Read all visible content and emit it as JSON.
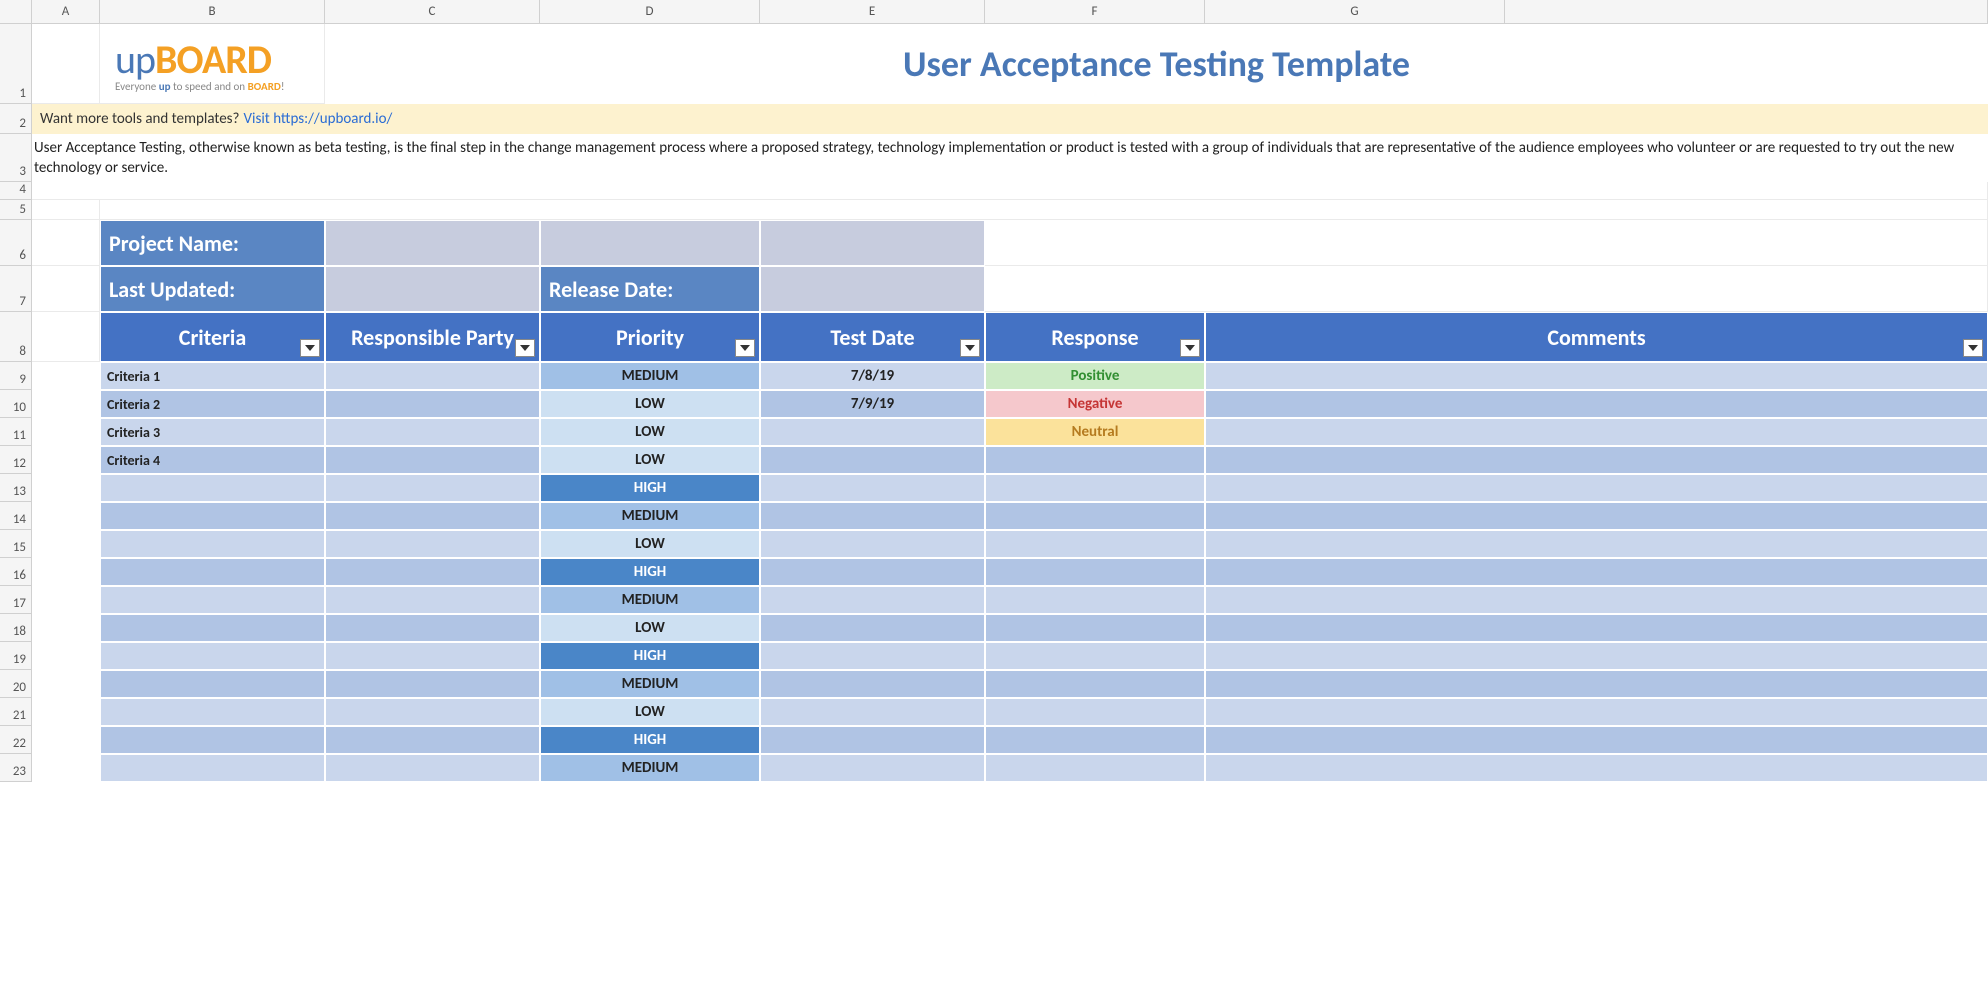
{
  "columns": [
    "A",
    "B",
    "C",
    "D",
    "E",
    "F",
    "G"
  ],
  "logo": {
    "prefix": "up",
    "suffix": "BOARD",
    "tag_pre": "Everyone ",
    "tag_up": "up",
    "tag_mid": " to speed and on ",
    "tag_board": "BOARD",
    "tag_post": "!"
  },
  "title": "User Acceptance Testing Template",
  "banner": {
    "prompt": "Want more tools and templates?",
    "link_text": "Visit https://upboard.io/"
  },
  "description": "User Acceptance Testing, otherwise known as beta testing, is the final step in the change management process where a proposed strategy, technology implementation or product is tested with a group of individuals that are representative of the audience employees who volunteer or are requested to try out the new technology or service.",
  "meta": {
    "project_label": "Project Name:",
    "project_value": "",
    "updated_label": "Last Updated:",
    "updated_value": "",
    "release_label": "Release Date:",
    "release_value": ""
  },
  "table": {
    "headers": {
      "criteria": "Criteria",
      "responsible": "Responsible Party",
      "priority": "Priority",
      "test_date": "Test Date",
      "response": "Response",
      "comments": "Comments"
    },
    "rows": [
      {
        "criteria": "Criteria 1",
        "responsible": "",
        "priority": "MEDIUM",
        "test_date": "7/8/19",
        "response": "Positive",
        "comments": ""
      },
      {
        "criteria": "Criteria 2",
        "responsible": "",
        "priority": "LOW",
        "test_date": "7/9/19",
        "response": "Negative",
        "comments": ""
      },
      {
        "criteria": "Criteria 3",
        "responsible": "",
        "priority": "LOW",
        "test_date": "",
        "response": "Neutral",
        "comments": ""
      },
      {
        "criteria": "Criteria 4",
        "responsible": "",
        "priority": "LOW",
        "test_date": "",
        "response": "",
        "comments": ""
      },
      {
        "criteria": "",
        "responsible": "",
        "priority": "HIGH",
        "test_date": "",
        "response": "",
        "comments": ""
      },
      {
        "criteria": "",
        "responsible": "",
        "priority": "MEDIUM",
        "test_date": "",
        "response": "",
        "comments": ""
      },
      {
        "criteria": "",
        "responsible": "",
        "priority": "LOW",
        "test_date": "",
        "response": "",
        "comments": ""
      },
      {
        "criteria": "",
        "responsible": "",
        "priority": "HIGH",
        "test_date": "",
        "response": "",
        "comments": ""
      },
      {
        "criteria": "",
        "responsible": "",
        "priority": "MEDIUM",
        "test_date": "",
        "response": "",
        "comments": ""
      },
      {
        "criteria": "",
        "responsible": "",
        "priority": "LOW",
        "test_date": "",
        "response": "",
        "comments": ""
      },
      {
        "criteria": "",
        "responsible": "",
        "priority": "HIGH",
        "test_date": "",
        "response": "",
        "comments": ""
      },
      {
        "criteria": "",
        "responsible": "",
        "priority": "MEDIUM",
        "test_date": "",
        "response": "",
        "comments": ""
      },
      {
        "criteria": "",
        "responsible": "",
        "priority": "LOW",
        "test_date": "",
        "response": "",
        "comments": ""
      },
      {
        "criteria": "",
        "responsible": "",
        "priority": "HIGH",
        "test_date": "",
        "response": "",
        "comments": ""
      },
      {
        "criteria": "",
        "responsible": "",
        "priority": "MEDIUM",
        "test_date": "",
        "response": "",
        "comments": ""
      }
    ]
  }
}
